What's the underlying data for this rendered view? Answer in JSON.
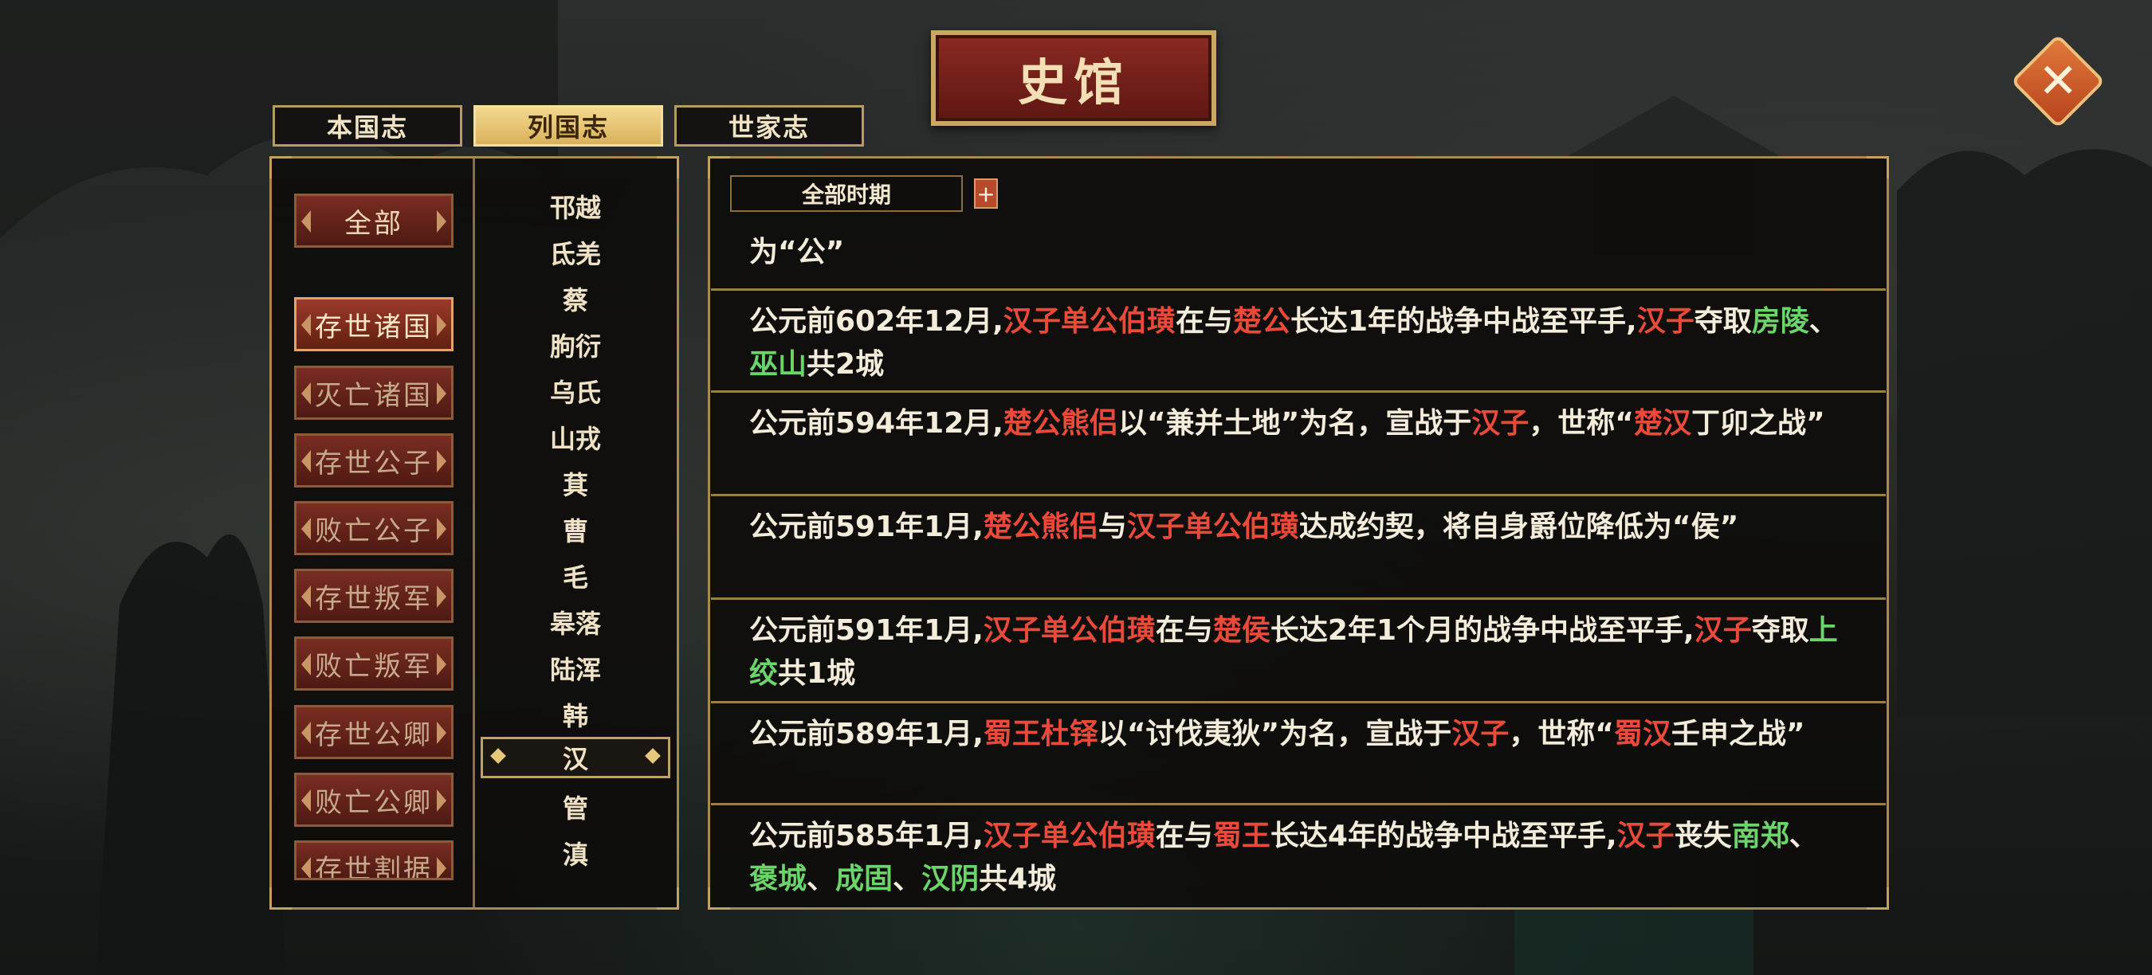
{
  "title": "史馆",
  "close_label": "✕",
  "tabs": [
    {
      "label": "本国志",
      "active": false
    },
    {
      "label": "列国志",
      "active": true
    },
    {
      "label": "世家志",
      "active": false
    }
  ],
  "categories": [
    {
      "label": "全部",
      "active": false
    },
    {
      "label": "存世诸国",
      "active": true
    },
    {
      "label": "灭亡诸国",
      "active": false
    },
    {
      "label": "存世公子",
      "active": false
    },
    {
      "label": "败亡公子",
      "active": false
    },
    {
      "label": "存世叛军",
      "active": false
    },
    {
      "label": "败亡叛军",
      "active": false
    },
    {
      "label": "存世公卿",
      "active": false
    },
    {
      "label": "败亡公卿",
      "active": false
    },
    {
      "label": "存世割据",
      "active": false
    }
  ],
  "states": [
    "邗越",
    "氐羌",
    "蔡",
    "朐衍",
    "乌氏",
    "山戎",
    "萁",
    "曹",
    "毛",
    "皋落",
    "陆浑",
    "韩",
    "汉",
    "管",
    "滇"
  ],
  "selected_state": "汉",
  "filter": {
    "period": "全部时期",
    "add_label": "+"
  },
  "records": [
    {
      "segments": [
        {
          "t": "为“公”",
          "c": ""
        }
      ]
    },
    {
      "segments": [
        {
          "t": "公元前602年12月,",
          "c": ""
        },
        {
          "t": "汉子单公伯璜",
          "c": "r"
        },
        {
          "t": "在与",
          "c": ""
        },
        {
          "t": "楚公",
          "c": "r"
        },
        {
          "t": "长达1年的战争中战至平手,",
          "c": ""
        },
        {
          "t": "汉子",
          "c": "r"
        },
        {
          "t": "夺取",
          "c": ""
        },
        {
          "t": "房陵",
          "c": "g"
        },
        {
          "t": "、",
          "c": ""
        },
        {
          "t": "巫山",
          "c": "g"
        },
        {
          "t": "共2城",
          "c": ""
        }
      ]
    },
    {
      "segments": [
        {
          "t": "公元前594年12月,",
          "c": ""
        },
        {
          "t": "楚公熊侣",
          "c": "r"
        },
        {
          "t": "以“兼并土地”为名，宣战于",
          "c": ""
        },
        {
          "t": "汉子",
          "c": "r"
        },
        {
          "t": "，世称“",
          "c": ""
        },
        {
          "t": "楚汉",
          "c": "r"
        },
        {
          "t": "丁卯之战”",
          "c": ""
        }
      ]
    },
    {
      "segments": [
        {
          "t": "公元前591年1月,",
          "c": ""
        },
        {
          "t": "楚公熊侣",
          "c": "r"
        },
        {
          "t": "与",
          "c": ""
        },
        {
          "t": "汉子单公伯璜",
          "c": "r"
        },
        {
          "t": "达成约契，将自身爵位降低为“侯”",
          "c": ""
        }
      ]
    },
    {
      "segments": [
        {
          "t": "公元前591年1月,",
          "c": ""
        },
        {
          "t": "汉子单公伯璜",
          "c": "r"
        },
        {
          "t": "在与",
          "c": ""
        },
        {
          "t": "楚侯",
          "c": "r"
        },
        {
          "t": "长达2年1个月的战争中战至平手,",
          "c": ""
        },
        {
          "t": "汉子",
          "c": "r"
        },
        {
          "t": "夺取",
          "c": ""
        },
        {
          "t": "上绞",
          "c": "g"
        },
        {
          "t": "共1城",
          "c": ""
        }
      ]
    },
    {
      "segments": [
        {
          "t": "公元前589年1月,",
          "c": ""
        },
        {
          "t": "蜀王杜铎",
          "c": "r"
        },
        {
          "t": "以“讨伐夷狄”为名，宣战于",
          "c": ""
        },
        {
          "t": "汉子",
          "c": "r"
        },
        {
          "t": "，世称“",
          "c": ""
        },
        {
          "t": "蜀汉",
          "c": "r"
        },
        {
          "t": "壬申之战”",
          "c": ""
        }
      ]
    },
    {
      "segments": [
        {
          "t": "公元前585年1月,",
          "c": ""
        },
        {
          "t": "汉子单公伯璜",
          "c": "r"
        },
        {
          "t": "在与",
          "c": ""
        },
        {
          "t": "蜀王",
          "c": "r"
        },
        {
          "t": "长达4年的战争中战至平手,",
          "c": ""
        },
        {
          "t": "汉子",
          "c": "r"
        },
        {
          "t": "丧失",
          "c": ""
        },
        {
          "t": "南郑",
          "c": "g"
        },
        {
          "t": "、",
          "c": ""
        },
        {
          "t": "褒城",
          "c": "g"
        },
        {
          "t": "、",
          "c": ""
        },
        {
          "t": "成固",
          "c": "g"
        },
        {
          "t": "、",
          "c": ""
        },
        {
          "t": "汉阴",
          "c": "g"
        },
        {
          "t": "共4城",
          "c": ""
        }
      ]
    }
  ]
}
